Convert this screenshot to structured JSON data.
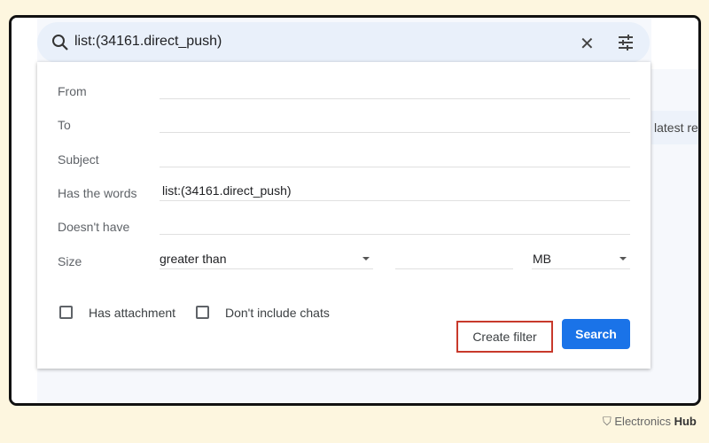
{
  "search": {
    "query": "list:(34161.direct_push)",
    "icons": [
      "search-icon",
      "close-icon",
      "tune-icon"
    ]
  },
  "background": {
    "partial_text": "latest rel"
  },
  "form": {
    "from_label": "From",
    "from_value": "",
    "to_label": "To",
    "to_value": "",
    "subject_label": "Subject",
    "subject_value": "",
    "has_words_label": "Has the words",
    "has_words_value": "list:(34161.direct_push)",
    "doesnt_have_label": "Doesn't have",
    "doesnt_have_value": "",
    "size_label": "Size",
    "size_operator": "greater than",
    "size_value": "",
    "size_unit": "MB",
    "has_attachment_label": "Has attachment",
    "has_attachment_checked": false,
    "no_chats_label": "Don't include chats",
    "no_chats_checked": false,
    "create_filter_label": "Create filter",
    "search_label": "Search"
  },
  "colors": {
    "accent": "#1a73e8",
    "highlight": "#c8392b"
  },
  "watermark": {
    "brand": "Electronics",
    "brand_bold": "Hub"
  }
}
